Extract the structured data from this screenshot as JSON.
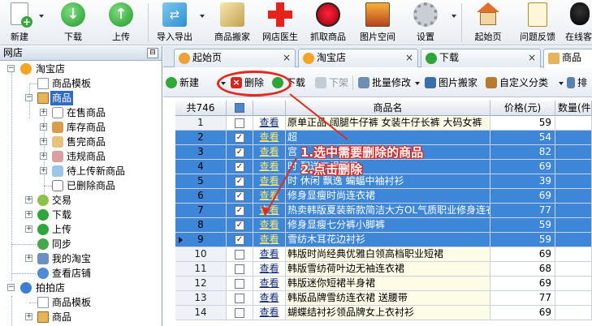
{
  "toolbar": {
    "items": [
      {
        "label": "新建",
        "icon": "new-doc-icon"
      },
      {
        "label": "下载",
        "icon": "download-icon"
      },
      {
        "label": "上传",
        "icon": "upload-icon"
      },
      {
        "label": "导入导出",
        "icon": "import-export-icon"
      },
      {
        "label": "商品搬家",
        "icon": "move-goods-icon"
      },
      {
        "label": "网店医生",
        "icon": "doctor-cross-icon"
      },
      {
        "label": "抓取商品",
        "icon": "spider-icon"
      },
      {
        "label": "图片空间",
        "icon": "picture-icon"
      },
      {
        "label": "设置",
        "icon": "gear-icon"
      },
      {
        "label": "起始页",
        "icon": "home-icon"
      },
      {
        "label": "问题反馈",
        "icon": "feedback-icon"
      },
      {
        "label": "在线客",
        "icon": "qq-penguin-icon"
      }
    ]
  },
  "left_panel": {
    "title": "网店",
    "pin_symbol": "⊟",
    "tree": [
      {
        "label": "淘宝店"
      },
      {
        "label": "商品模板"
      },
      {
        "label": "商品"
      },
      {
        "label": "在售商品"
      },
      {
        "label": "库存商品"
      },
      {
        "label": "售完商品"
      },
      {
        "label": "违规商品"
      },
      {
        "label": "待上传新商品"
      },
      {
        "label": "已删除商品"
      },
      {
        "label": "交易"
      },
      {
        "label": "下载"
      },
      {
        "label": "上传"
      },
      {
        "label": "同步"
      },
      {
        "label": "我的淘宝"
      },
      {
        "label": "查看店铺"
      },
      {
        "label": "拍拍店"
      },
      {
        "label": "商品模板"
      },
      {
        "label": "商品"
      }
    ]
  },
  "tabs": [
    {
      "label": "起始页"
    },
    {
      "label": "淘宝店"
    },
    {
      "label": "下载"
    },
    {
      "label": "商品"
    }
  ],
  "tab_close": "×",
  "subtoolbar": {
    "new": "新建",
    "delete": "删除",
    "download": "下载",
    "unlist": "下架",
    "batch_edit": "批量修改",
    "pic_move": "图片搬家",
    "custom_category": "自定义分类",
    "sort": "排"
  },
  "grid": {
    "headers": {
      "count": "共746",
      "name": "商品名",
      "price": "价格(元)",
      "qty": "数量(件"
    },
    "view_text": "查看",
    "check_mark": "✓",
    "rows": [
      {
        "num": "1",
        "checked": false,
        "selected": false,
        "name": "原单正品 阔腿牛仔裤 女装牛仔长裤 大码女裤",
        "price": "59"
      },
      {
        "num": "2",
        "checked": true,
        "selected": true,
        "name": "超",
        "price": "54"
      },
      {
        "num": "3",
        "checked": true,
        "selected": true,
        "name": "宫",
        "price": "82"
      },
      {
        "num": "4",
        "checked": true,
        "selected": true,
        "name": "时 配送二根腰带",
        "price": "69"
      },
      {
        "num": "5",
        "checked": true,
        "selected": true,
        "name": "时 休闲 飘逸 蝙蝠中袖衬衫",
        "price": "39"
      },
      {
        "num": "6",
        "checked": true,
        "selected": true,
        "name": "修身显瘦时尚连衣裙",
        "price": "69"
      },
      {
        "num": "7",
        "checked": true,
        "selected": true,
        "name": "热卖韩版夏装新款简洁大方OL气质职业修身连衣",
        "price": "77"
      },
      {
        "num": "8",
        "checked": true,
        "selected": true,
        "name": "修身显瘦七分裤小脚裤",
        "price": "59"
      },
      {
        "num": "9",
        "checked": true,
        "selected": true,
        "name": "雪纺木耳花边衬衫",
        "price": "59"
      },
      {
        "num": "10",
        "checked": false,
        "selected": false,
        "name": "韩版时尚经典优雅白领高档职业短裙",
        "price": "69"
      },
      {
        "num": "11",
        "checked": false,
        "selected": false,
        "name": "韩版雪纺荷叶边无袖连衣裙",
        "price": "68"
      },
      {
        "num": "12",
        "checked": false,
        "selected": false,
        "name": "韩版迷你短裙半身裙",
        "price": "69"
      },
      {
        "num": "13",
        "checked": false,
        "selected": false,
        "name": "韩版品牌雪纺连衣裙 送腰带",
        "price": "77"
      },
      {
        "num": "14",
        "checked": false,
        "selected": false,
        "name": "蝴蝶结衬衫领品牌女上衣衬衫",
        "price": "69"
      }
    ]
  },
  "annotations": {
    "step1": "1.选中需要删除的商品",
    "step2": "2.点击删除"
  },
  "colors": {
    "selection_blue": "#3d86d8",
    "annotation_red": "#e42a1f",
    "link_yellow": "#ffe96b"
  }
}
